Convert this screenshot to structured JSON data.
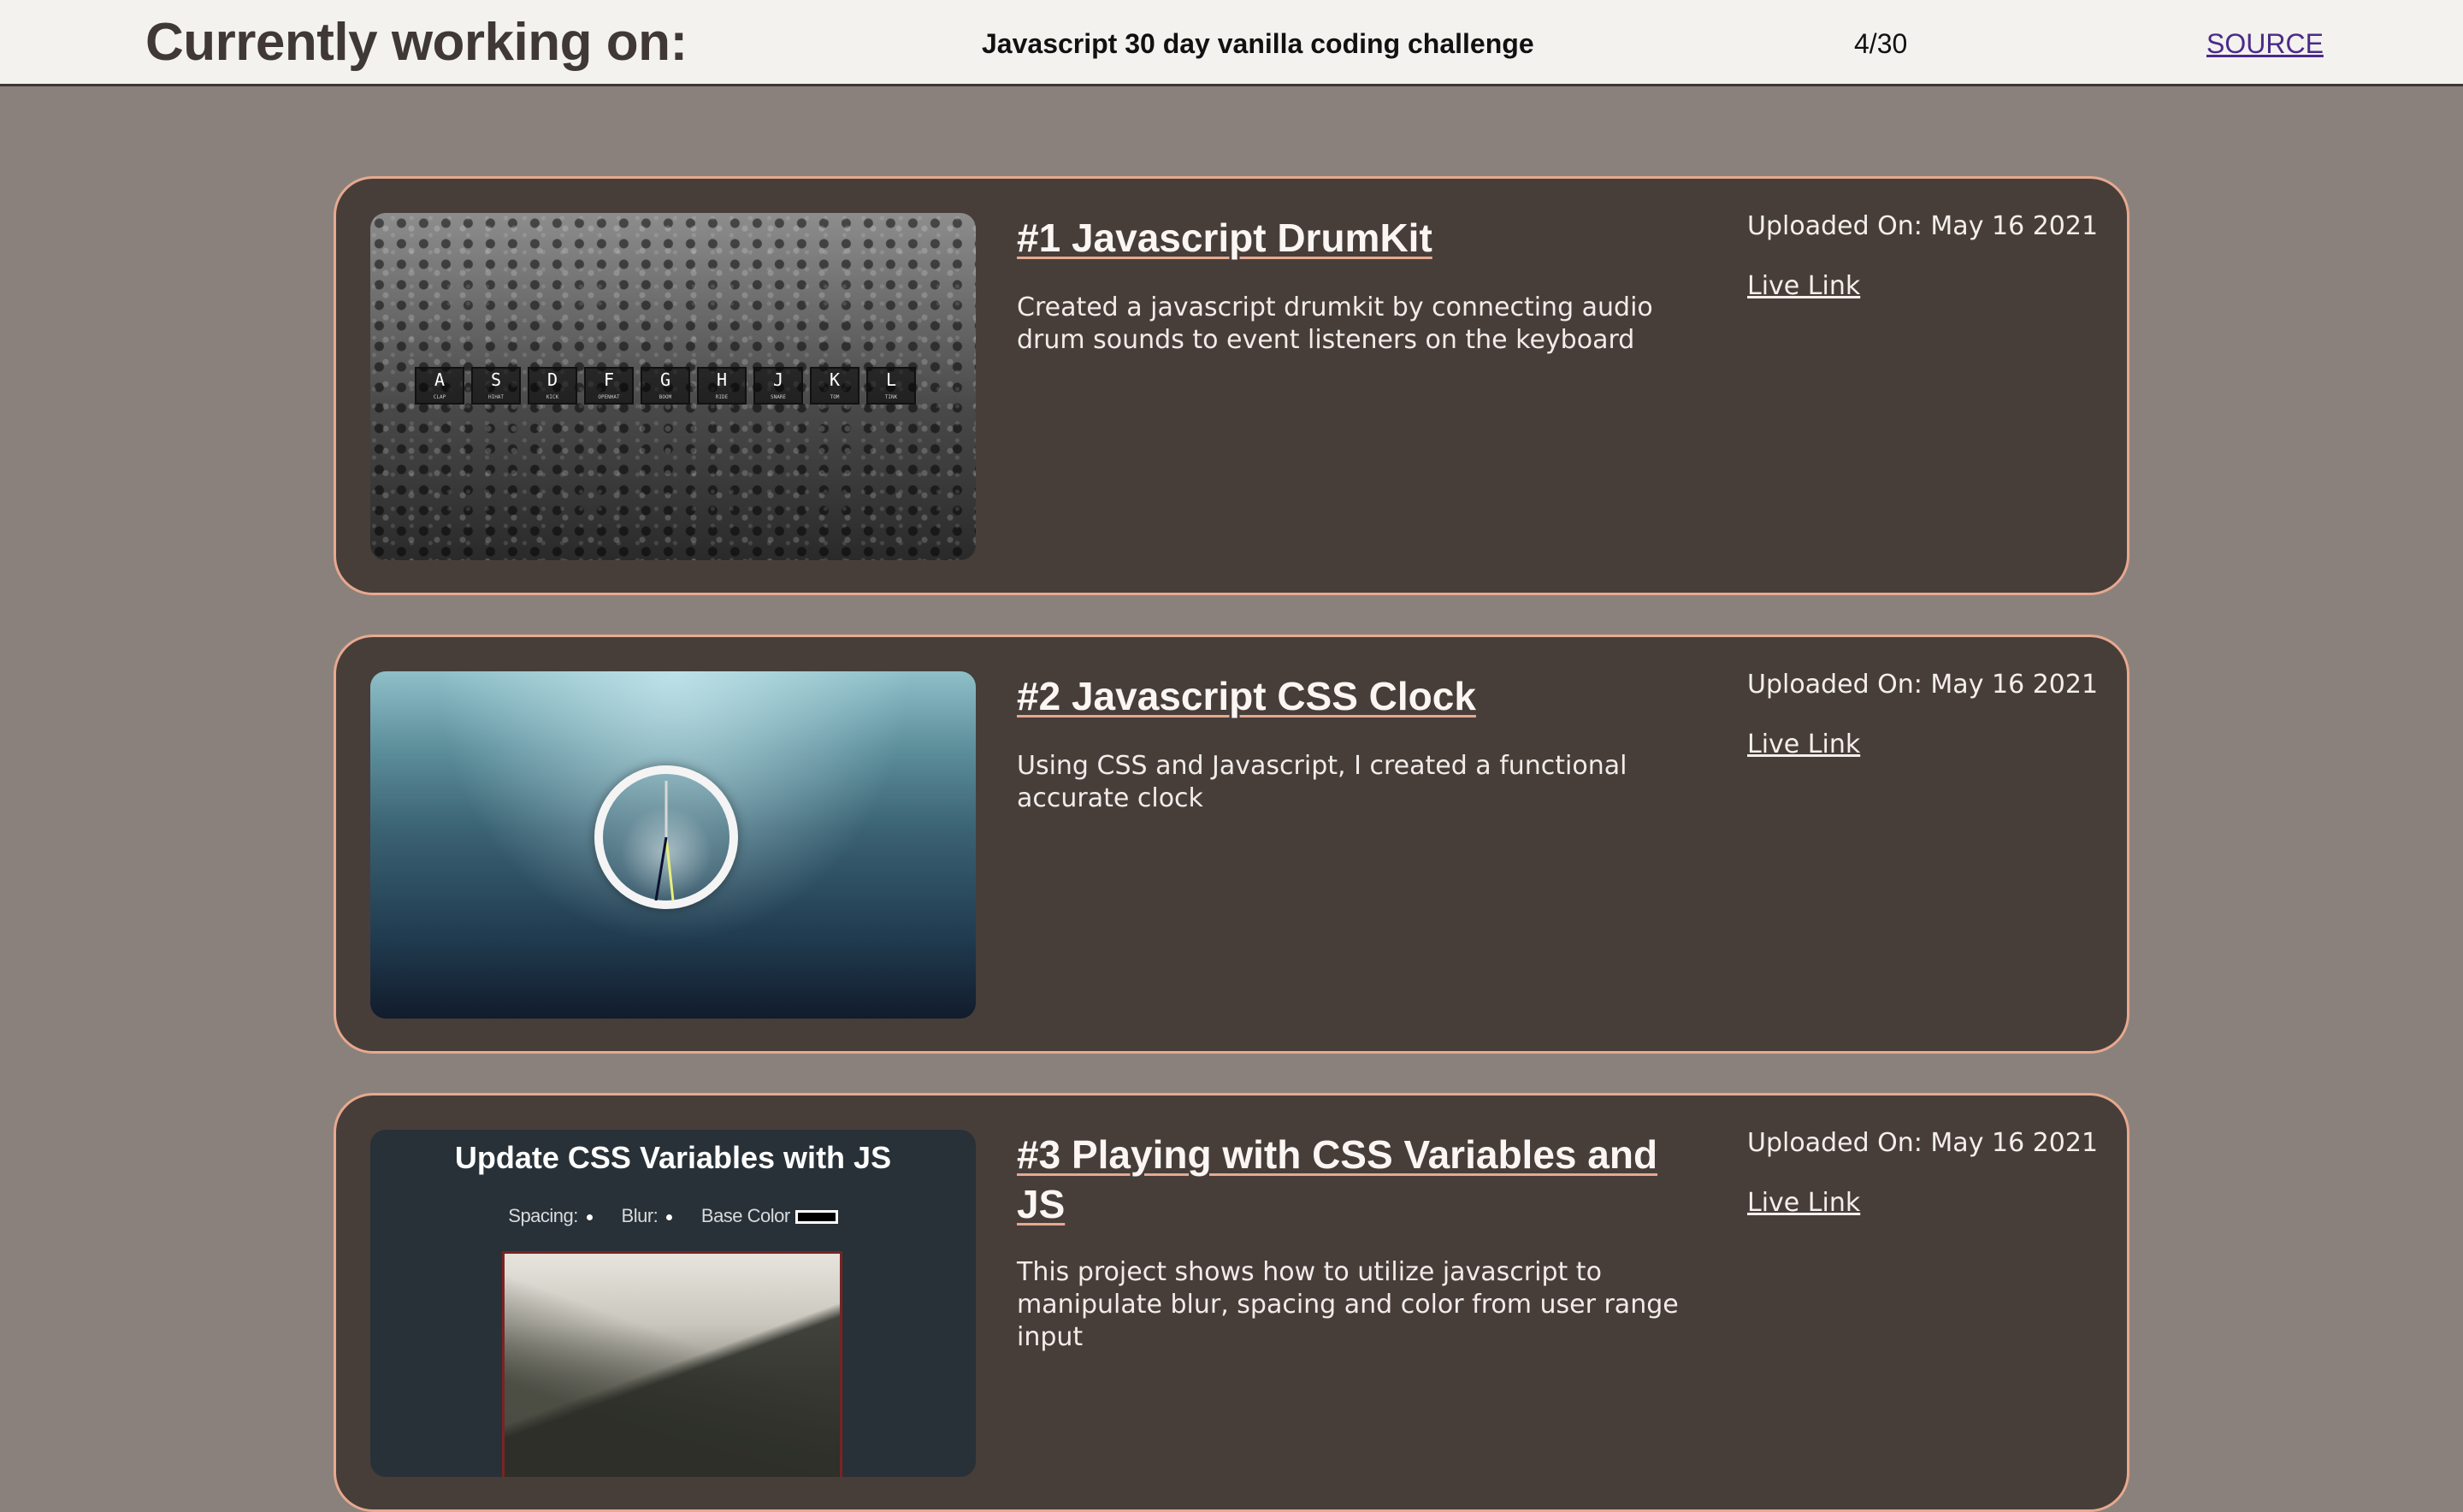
{
  "header": {
    "title": "Currently working on:",
    "challenge": "Javascript 30 day vanilla coding challenge",
    "progress": "4/30",
    "source_label": "SOURCE"
  },
  "projects": [
    {
      "title": "#1 Javascript DrumKit",
      "description": "Created a javascript drumkit by connecting audio drum sounds to event listeners on the keyboard",
      "uploaded": "Uploaded On: May 16 2021",
      "link_label": "Live Link",
      "thumbnail": {
        "keys": [
          {
            "key": "A",
            "sound": "CLAP"
          },
          {
            "key": "S",
            "sound": "HIHAT"
          },
          {
            "key": "D",
            "sound": "KICK"
          },
          {
            "key": "F",
            "sound": "OPENHAT"
          },
          {
            "key": "G",
            "sound": "BOOM"
          },
          {
            "key": "H",
            "sound": "RIDE"
          },
          {
            "key": "J",
            "sound": "SNARE"
          },
          {
            "key": "K",
            "sound": "TOM"
          },
          {
            "key": "L",
            "sound": "TINK"
          }
        ]
      }
    },
    {
      "title": "#2 Javascript CSS Clock",
      "description": "Using CSS and Javascript, I created a functional accurate clock",
      "uploaded": "Uploaded On: May 16 2021",
      "link_label": "Live Link"
    },
    {
      "title": "#3 Playing with CSS Variables and JS",
      "description": "This project shows how to utilize javascript to manipulate blur, spacing and color from user range input",
      "uploaded": "Uploaded On: May 16 2021",
      "link_label": "Live Link",
      "thumbnail": {
        "heading": "Update CSS Variables with JS",
        "controls": [
          "Spacing:",
          "Blur:",
          "Base Color"
        ]
      }
    }
  ],
  "colors": {
    "page_background": "#8b817c",
    "header_background": "#f3f2ee",
    "card_background": "#473e3a",
    "card_border": "#e7a98f",
    "source_link": "#4b2a8a"
  }
}
